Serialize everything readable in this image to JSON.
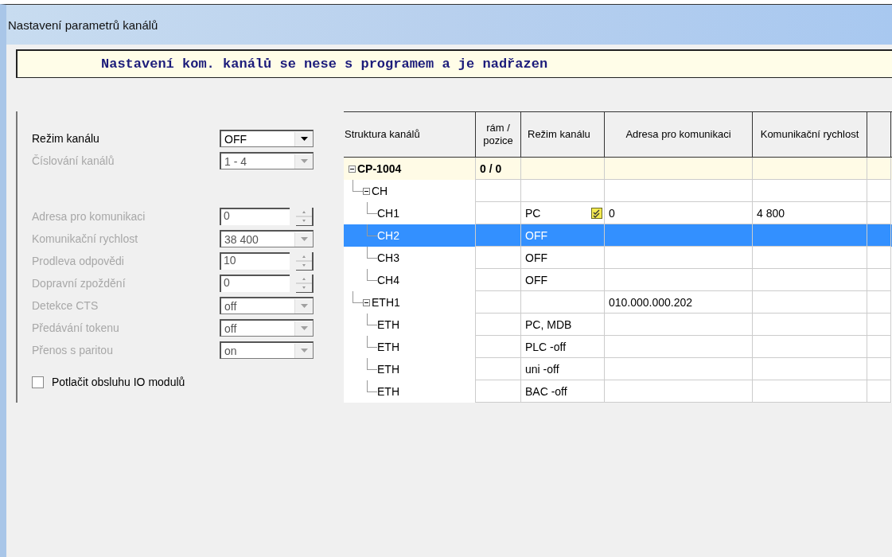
{
  "window": {
    "title": "Nastavení parametrů kanálů"
  },
  "banner": "Nastavení kom. kanálů se nese s programem a je nadřazen",
  "channel_settings": [
    {
      "kind": "select",
      "label": "Režim kanálu",
      "value": "OFF",
      "disabled": false
    },
    {
      "kind": "select",
      "label": "Číslování kanálů",
      "value": "1 - 4",
      "disabled": true
    }
  ],
  "comm_settings": [
    {
      "kind": "spin",
      "label": "Adresa pro komunikaci",
      "value": "0",
      "disabled": true
    },
    {
      "kind": "select",
      "label": "Komunikační rychlost",
      "value": "38 400",
      "disabled": true
    },
    {
      "kind": "spin",
      "label": "Prodleva odpovědi",
      "value": "10",
      "disabled": true
    },
    {
      "kind": "spin",
      "label": "Dopravní zpoždění",
      "value": "0",
      "disabled": true
    },
    {
      "kind": "select",
      "label": "Detekce CTS",
      "value": "off",
      "disabled": true
    },
    {
      "kind": "select",
      "label": "Předávání tokenu",
      "value": "off",
      "disabled": true
    },
    {
      "kind": "select",
      "label": "Přenos s paritou",
      "value": "on",
      "disabled": true
    }
  ],
  "suppress_io": {
    "label": "Potlačit obsluhu IO modulů",
    "checked": false
  },
  "table": {
    "columns": [
      "Struktura kanálů",
      "rám / pozice",
      "Režim kanálu",
      "Adresa pro komunikaci",
      "Komunikační rychlost"
    ],
    "rows": [
      {
        "name": "CP-1004",
        "frame": "0 / 0",
        "bold": true,
        "selected": false,
        "expanded": true,
        "children": [
          {
            "name": "CH",
            "bold": false,
            "selected": false,
            "expanded": true,
            "children": [
              {
                "name": "CH1",
                "mode": "PC",
                "address": "0",
                "speed": "4 800",
                "bold": false,
                "selected": false,
                "note_icon": true
              },
              {
                "name": "CH2",
                "mode": "OFF",
                "bold": false,
                "selected": true
              },
              {
                "name": "CH3",
                "mode": "OFF",
                "bold": false,
                "selected": false
              },
              {
                "name": "CH4",
                "mode": "OFF",
                "bold": false,
                "selected": false
              }
            ]
          },
          {
            "name": "ETH1",
            "address": "010.000.000.202",
            "bold": false,
            "selected": false,
            "expanded": true,
            "children": [
              {
                "name": "ETH",
                "mode": "PC, MDB",
                "bold": false,
                "selected": false
              },
              {
                "name": "ETH",
                "mode": "PLC -off",
                "bold": false,
                "selected": false
              },
              {
                "name": "ETH",
                "mode": "uni -off",
                "bold": false,
                "selected": false
              },
              {
                "name": "ETH",
                "mode": "BAC -off",
                "bold": false,
                "selected": false
              }
            ]
          }
        ]
      }
    ]
  }
}
